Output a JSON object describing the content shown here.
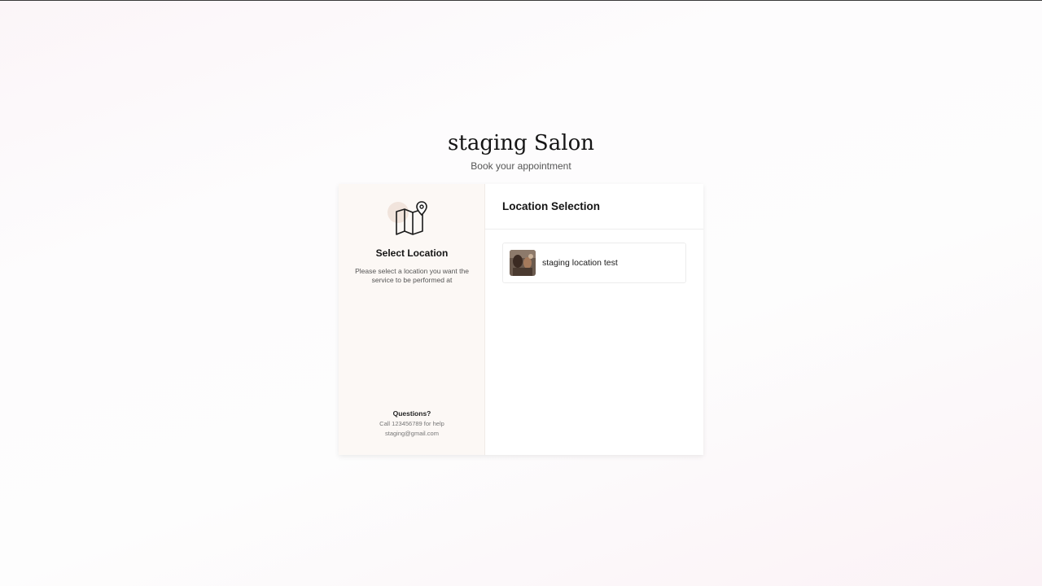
{
  "header": {
    "salon_name": "staging Salon",
    "subtitle": "Book your appointment"
  },
  "sidebar": {
    "icon": "map-location-icon",
    "title": "Select Location",
    "description": "Please select a location you want the service to be performed at",
    "help": {
      "title": "Questions?",
      "phone_line": "Call 123456789 for help",
      "email": "staging@gmail.com"
    }
  },
  "main": {
    "title": "Location Selection",
    "locations": [
      {
        "name": "staging location test",
        "thumb": "location-photo"
      }
    ]
  },
  "colors": {
    "sidebar_bg": "#fcf8f5",
    "accent_circle": "#f1e4dc",
    "text": "#151515"
  }
}
